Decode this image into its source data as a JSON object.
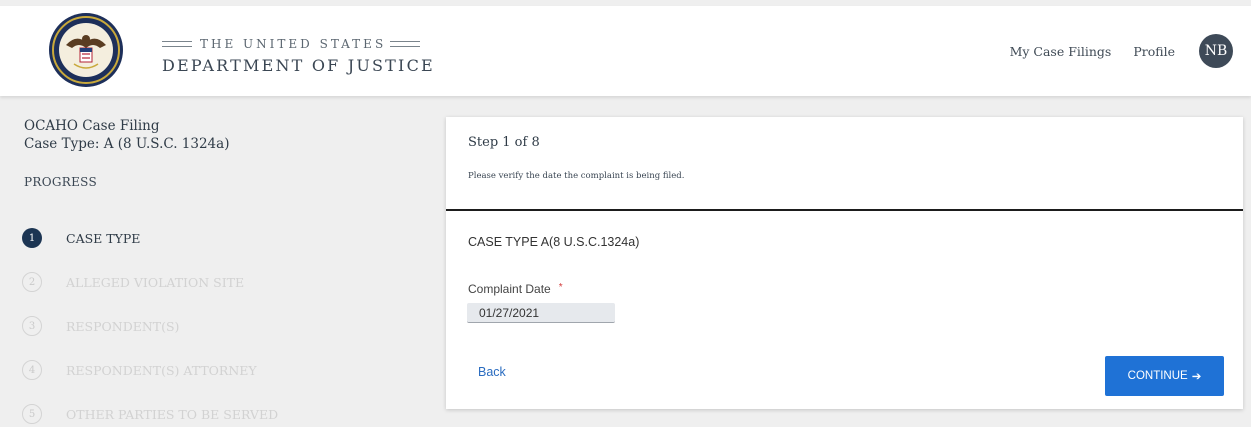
{
  "header": {
    "agency_line1": "THE UNITED STATES",
    "agency_line2": "DEPARTMENT OF JUSTICE",
    "nav": {
      "my_case_filings": "My Case Filings",
      "profile": "Profile"
    },
    "avatar_initials": "NB",
    "seal_icon": "doj-seal-icon"
  },
  "sidebar": {
    "filing_title": "OCAHO Case Filing",
    "case_type": "Case Type: A (8 U.S.C. 1324a)",
    "progress_label": "PROGRESS",
    "steps": [
      {
        "num": "1",
        "label": "CASE TYPE",
        "state": "active"
      },
      {
        "num": "2",
        "label": "ALLEGED VIOLATION SITE",
        "state": "inactive"
      },
      {
        "num": "3",
        "label": "RESPONDENT(S)",
        "state": "inactive"
      },
      {
        "num": "4",
        "label": "RESPONDENT(S) ATTORNEY",
        "state": "inactive"
      },
      {
        "num": "5",
        "label": "OTHER PARTIES TO BE SERVED",
        "state": "inactive"
      }
    ]
  },
  "main": {
    "step_indicator": "Step 1 of 8",
    "instruction": "Please verify the date the complaint is being filed.",
    "case_heading": "CASE TYPE A(8 U.S.C.1324a)",
    "complaint_date_label": "Complaint Date",
    "required_marker": "*",
    "complaint_date_value": "01/27/2021",
    "back_label": "Back",
    "continue_label": "CONTINUE",
    "continue_arrow": "➔"
  },
  "colors": {
    "primary_button": "#1f72d6",
    "active_step": "#1c3553",
    "avatar": "#3e4a58",
    "link": "#2a6cc0",
    "required": "#d33b3b"
  }
}
